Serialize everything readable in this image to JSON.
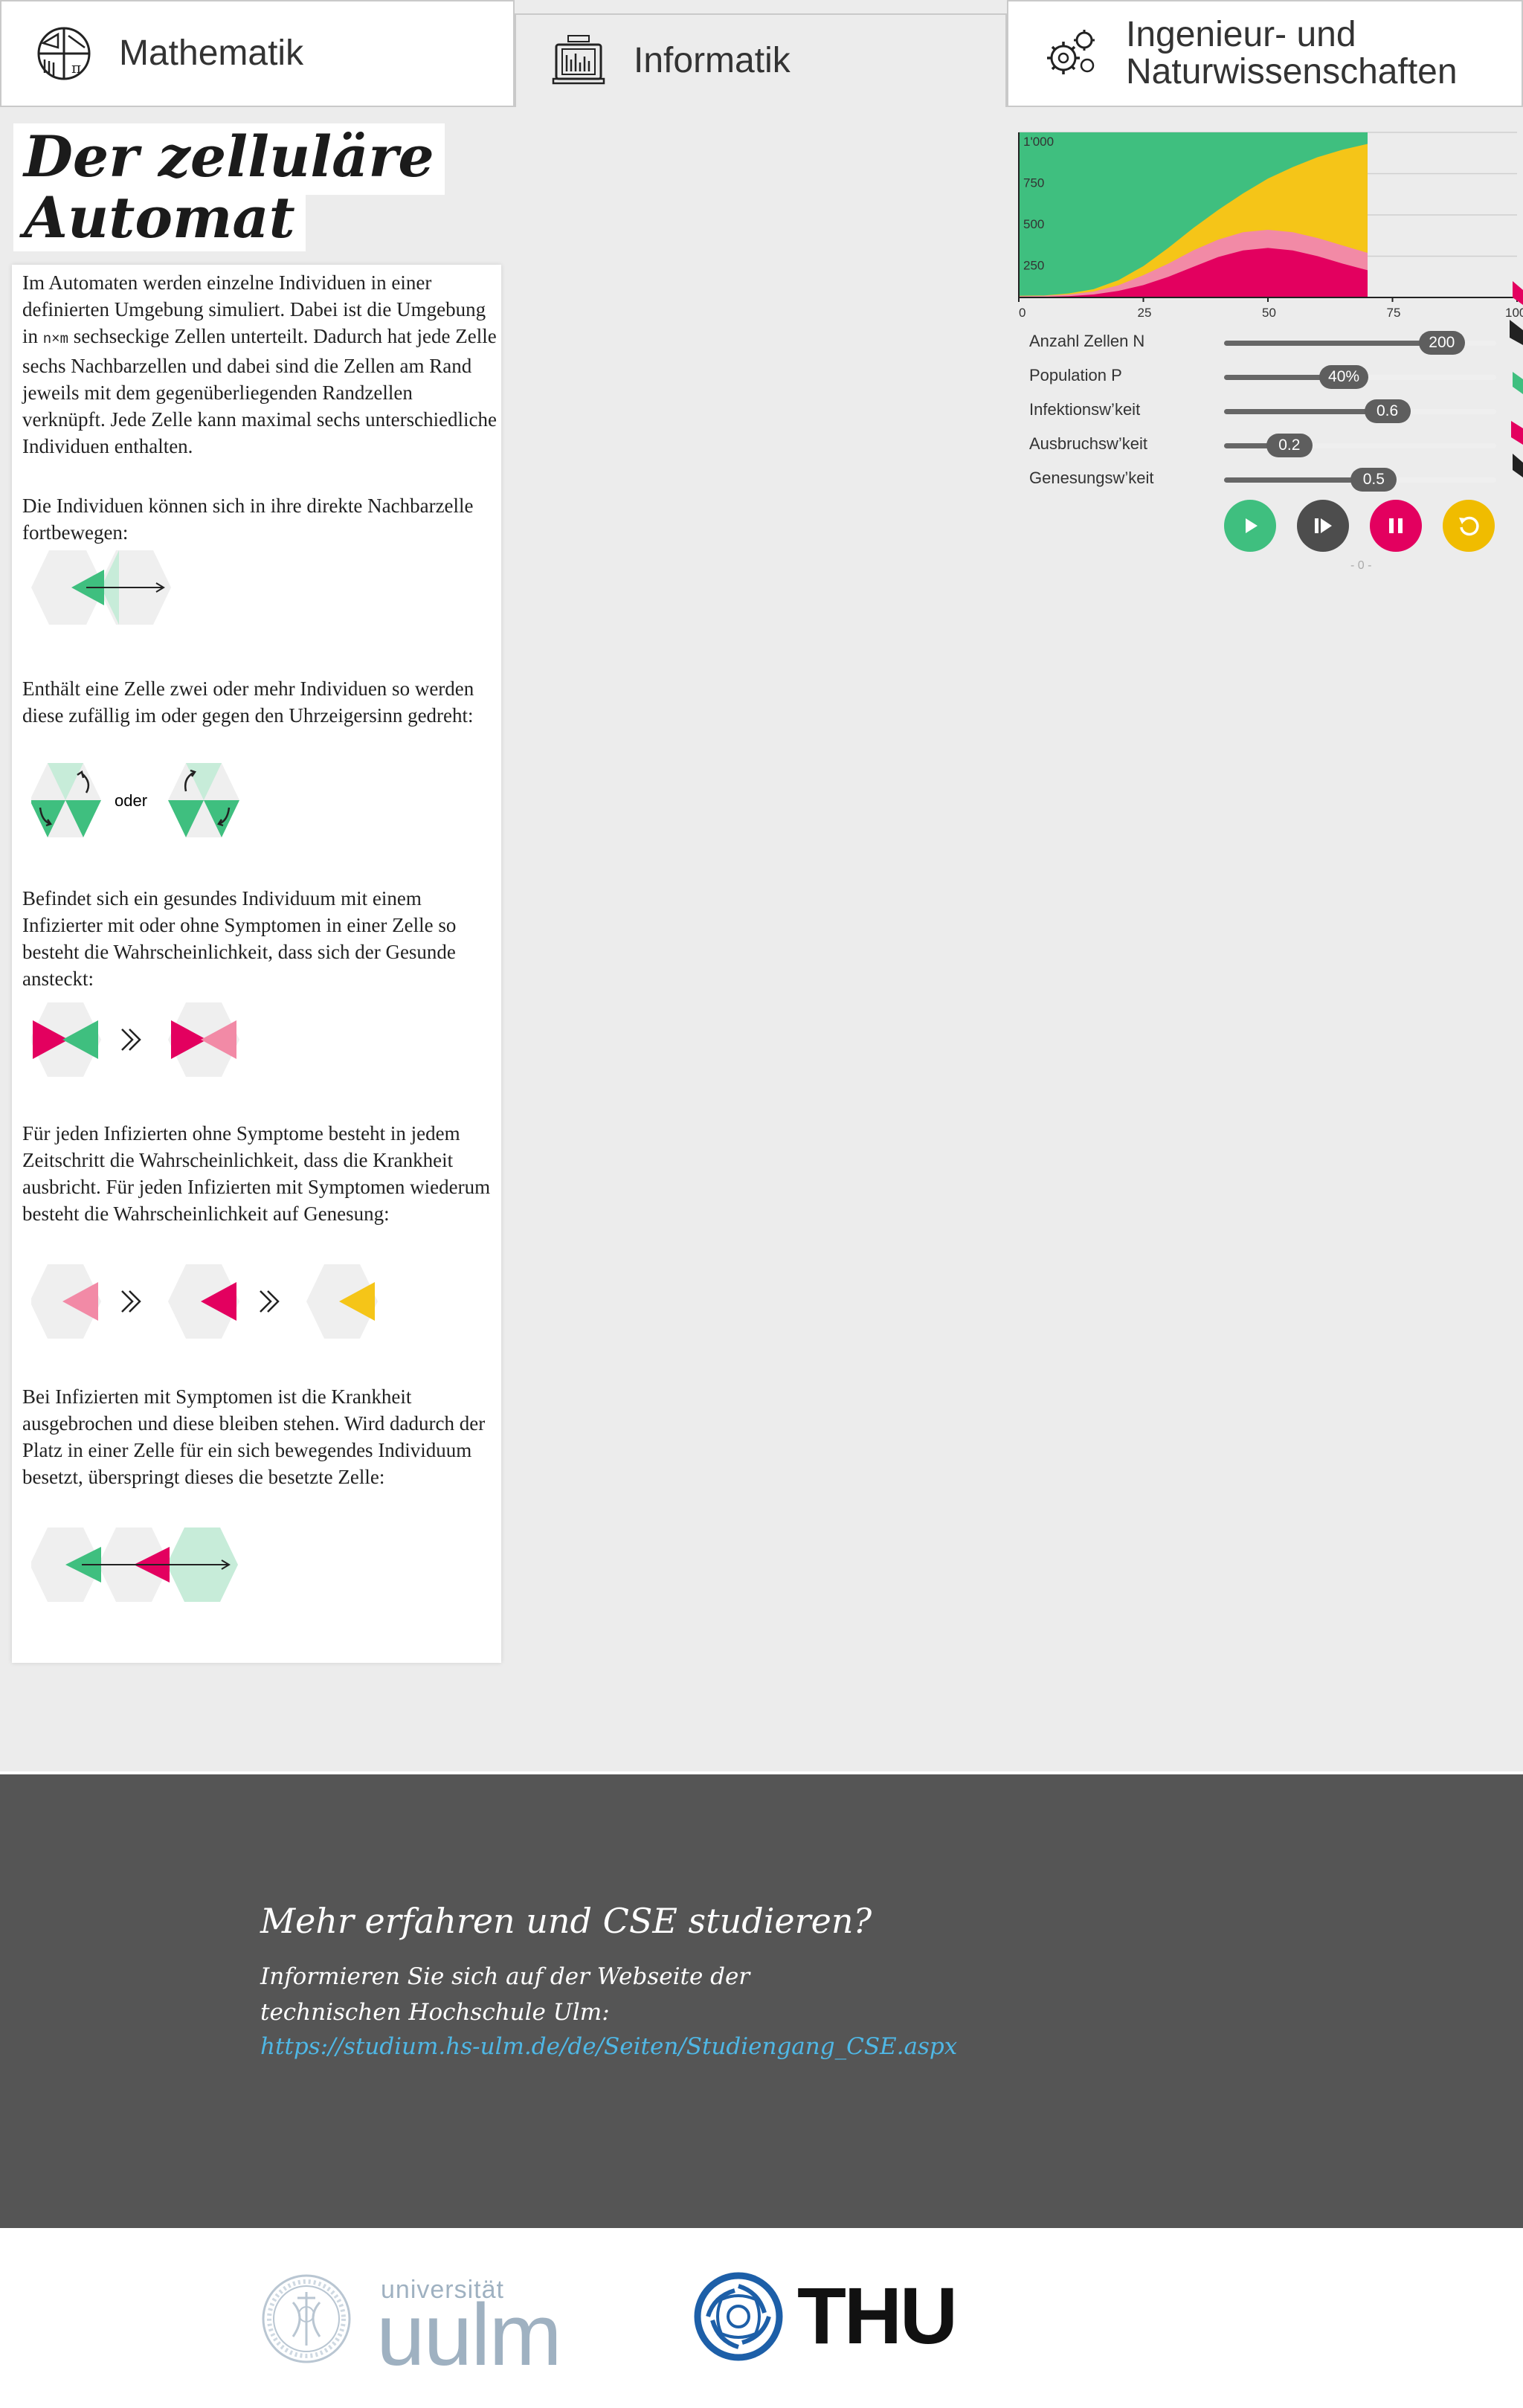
{
  "tabs": [
    {
      "label": "Mathematik",
      "icon": "math-icon"
    },
    {
      "label": "Informatik",
      "icon": "computer-icon"
    },
    {
      "label_line1": "Ingenieur- und",
      "label_line2": "Naturwissenschaften",
      "icon": "gears-icon"
    }
  ],
  "active_tab": "Informatik",
  "title": {
    "line1": "Der zelluläre",
    "line2": "Automat"
  },
  "paragraphs": {
    "p1_a": "Im Automaten werden einzelne Individuen in einer definierten Umgebung simuliert. Dabei ist die Umgebung in ",
    "p1_mono": "n×m",
    "p1_b": " sechseckige Zellen unterteilt. Dadurch hat jede Zelle sechs Nachbarzellen und dabei sind die Zellen am Rand jeweils mit dem gegenüberliegenden Randzellen verknüpft. Jede Zelle kann maximal sechs unterschiedliche Individuen enthalten.",
    "p2": "Die Individuen können sich in ihre direkte Nachbarzelle fortbewegen:",
    "p3": "Enthält eine Zelle zwei oder mehr Individuen so werden diese zufällig im oder gegen den Uhrzeigersinn gedreht:",
    "p4": "Befindet sich ein gesundes Individuum mit einem Infizierter mit oder ohne Symptomen in einer Zelle so besteht die Wahrscheinlichkeit, dass sich der Gesunde ansteckt:",
    "p5": "Für jeden Infizierten ohne Symptome besteht in jedem Zeitschritt die Wahrscheinlichkeit, dass die Krankheit ausbricht. Für jeden Infizierten mit Symptomen wiederum besteht die Wahrscheinlichkeit auf Genesung:",
    "p6": "Bei Infizierten mit Symptomen ist die Krankheit ausgebrochen und diese bleiben stehen. Wird dadurch der Platz in einer Zelle für ein sich bewegendes Individuum besetzt, überspringt dieses die besetzte Zelle:"
  },
  "oder_label": "oder",
  "colors": {
    "healthy": "#3fbf7f",
    "healthy_light": "#c7ecd9",
    "infected_no_symptoms": "#f28aa6",
    "infected_symptoms": "#e3005f",
    "recovered": "#f5c518",
    "hex": "#efefef"
  },
  "chart_data": {
    "type": "area",
    "x": [
      0,
      5,
      10,
      15,
      20,
      25,
      30,
      35,
      40,
      45,
      50,
      55,
      60,
      65,
      70
    ],
    "series": [
      {
        "values": [
          4,
          4,
          8,
          18,
          40,
          75,
          125,
          185,
          245,
          285,
          300,
          285,
          250,
          205,
          165
        ]
      },
      {
        "values": [
          8,
          10,
          18,
          36,
          74,
          135,
          205,
          285,
          350,
          395,
          410,
          395,
          360,
          315,
          270
        ]
      },
      {
        "values": [
          10,
          12,
          24,
          50,
          105,
          190,
          300,
          420,
          530,
          630,
          720,
          790,
          850,
          895,
          930
        ]
      },
      {
        "values": [
          1000,
          1000,
          1000,
          1000,
          1000,
          1000,
          1000,
          1000,
          1000,
          1000,
          1000,
          1000,
          1000,
          1000,
          1000
        ]
      }
    ],
    "y_ticks": [
      "250",
      "500",
      "750",
      "1'000"
    ],
    "x_ticks": [
      "0",
      "25",
      "50",
      "75",
      "100"
    ],
    "xlim": [
      0,
      100
    ],
    "ylim": [
      0,
      1000
    ],
    "grid": true
  },
  "sliders": [
    {
      "label": "Anzahl Zellen N",
      "value": "200",
      "fraction": 0.82
    },
    {
      "label": "Population P",
      "value": "40%",
      "fraction": 0.44
    },
    {
      "label": "Infektionsw’keit",
      "value": "0.6",
      "fraction": 0.6
    },
    {
      "label": "Ausbruchsw’keit",
      "value": "0.2",
      "fraction": 0.25
    },
    {
      "label": "Genesungsw’keit",
      "value": "0.5",
      "fraction": 0.55
    }
  ],
  "controls": [
    "play-icon",
    "step-icon",
    "pause-icon",
    "reset-icon"
  ],
  "tiny_label": "- 0 -",
  "footer": {
    "heading": "Mehr erfahren und CSE studieren?",
    "line1": "Informieren Sie sich auf der Webseite der",
    "line2": "technischen Hochschule Ulm:",
    "link": "https://studium.hs-ulm.de/de/Seiten/Studiengang_CSE.aspx"
  },
  "logos": {
    "uulm_small": "universität",
    "uulm_big": "uulm",
    "thu": "THU"
  }
}
